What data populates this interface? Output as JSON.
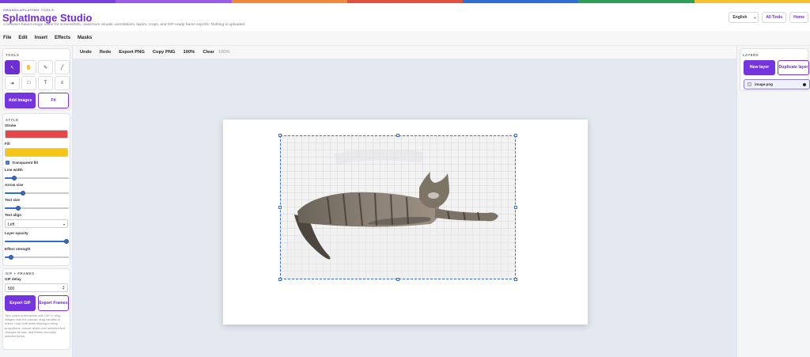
{
  "colors": {
    "accent": "#7434e0",
    "rainbow": [
      "#7a3fe0",
      "#9b5de5",
      "#ef8a3a",
      "#e0513f",
      "#2f6fd1",
      "#2e9e57",
      "#f2c230"
    ]
  },
  "header": {
    "eyebrow": "GRANOLAPLAYING TOOLS",
    "title": "SplatImage Studio",
    "subtitle": "A browser-based image editor for screenshots, classroom visuals, annotations, layers, crops, and GIF-ready frame exports. Nothing is uploaded.",
    "language": "English",
    "all_tools": "All Tools",
    "home": "Home"
  },
  "menu": [
    "File",
    "Edit",
    "Insert",
    "Effects",
    "Masks"
  ],
  "tools": {
    "title": "TOOLS",
    "buttons": [
      {
        "name": "select-tool-icon",
        "glyph": "↖"
      },
      {
        "name": "hand-tool-icon",
        "glyph": "✋"
      },
      {
        "name": "pencil-tool-icon",
        "glyph": "✎"
      },
      {
        "name": "line-tool-icon",
        "glyph": "╱"
      },
      {
        "name": "arrow-tool-icon",
        "glyph": "➜"
      },
      {
        "name": "rectangle-tool-icon",
        "glyph": "□"
      },
      {
        "name": "text-tool-icon",
        "glyph": "T"
      },
      {
        "name": "blur-tool-icon",
        "glyph": "≡"
      }
    ],
    "add_images": "Add Images",
    "fit": "Fit"
  },
  "style": {
    "title": "STYLE",
    "stroke_label": "Stroke",
    "stroke_color": "#e8474a",
    "fill_label": "Fill",
    "fill_color": "#f5c518",
    "transparent_fill": "Transparent fill",
    "transparent_fill_checked": true,
    "line_width_label": "Line width",
    "line_width_level": 0.12,
    "arrow_size_label": "Arrow size",
    "arrow_size_level": 0.26,
    "text_size_label": "Text size",
    "text_size_level": 0.19,
    "text_align_label": "Text align",
    "text_align_value": "Left",
    "layer_opacity_label": "Layer opacity",
    "layer_opacity_level": 1.0,
    "effect_strength_label": "Effect strength",
    "effect_strength_level": 0.06
  },
  "gif": {
    "title": "GIF + FRAMES",
    "delay_label": "GIF delay",
    "delay_value": "500",
    "export_gif": "Export GIF",
    "export_frames": "Export Frames",
    "tip": "Tips: paste screenshots with Ctrl+V, drag images onto the canvas, drag handles to resize, hold Shift while resizing to keep proportions, mouse wheel over selected text changes its size, and Delete removes selected items."
  },
  "toolbar": {
    "undo": "Undo",
    "redo": "Redo",
    "export_png": "Export PNG",
    "copy_png": "Copy PNG",
    "zoom_button": "100%",
    "clear": "Clear",
    "zoom_readout": "100%"
  },
  "layers": {
    "title": "LAYERS",
    "new_layer": "New layer",
    "duplicate_layer": "Duplicate layer",
    "items": [
      {
        "name": "image.png"
      }
    ]
  }
}
